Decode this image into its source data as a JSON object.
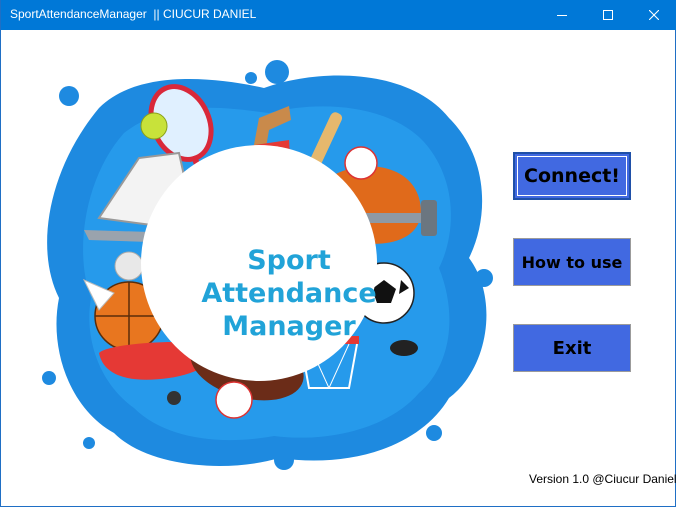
{
  "window": {
    "title": "SportAttendanceManager  || CIUCUR DANIEL",
    "controls": [
      "minimize-icon",
      "maximize-icon",
      "close-icon"
    ]
  },
  "logo": {
    "lines": [
      "Sport",
      "Attendance",
      "Manager"
    ],
    "colors": {
      "text": "#21a3d8",
      "splash": "#1e8ae0",
      "circle": "#ffffff"
    }
  },
  "buttons": {
    "connect": "Connect!",
    "how_to_use": "How to use",
    "exit": "Exit",
    "color": "#4169e1"
  },
  "footer": {
    "version": "Version 1.0 @Ciucur Daniel"
  }
}
